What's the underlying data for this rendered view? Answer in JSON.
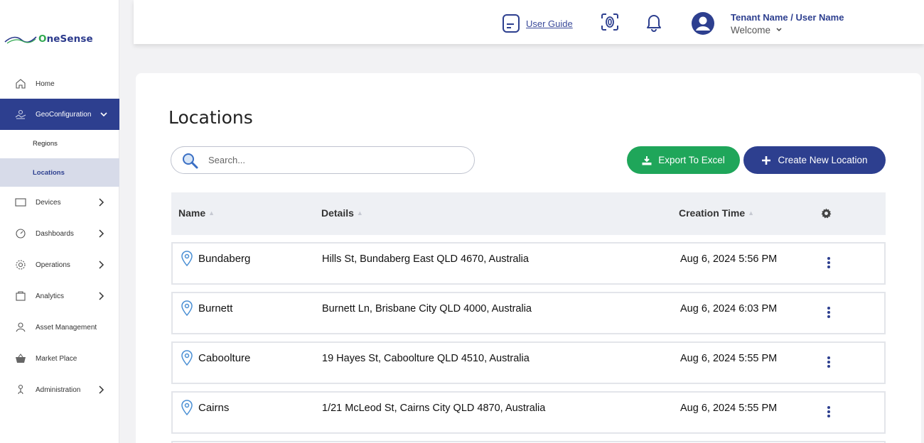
{
  "brand": {
    "logo_text": "neSense",
    "logo_o": "O"
  },
  "sidebar": {
    "items": [
      {
        "label": "Home",
        "icon": "home-icon"
      },
      {
        "label": "GeoConfiguration",
        "icon": "map-icon"
      },
      {
        "label": "Devices",
        "icon": "device-icon"
      },
      {
        "label": "Dashboards",
        "icon": "dashboard-icon"
      },
      {
        "label": "Operations",
        "icon": "gear-icon"
      },
      {
        "label": "Analytics",
        "icon": "analytics-icon"
      },
      {
        "label": "Asset Management",
        "icon": "asset-icon"
      },
      {
        "label": "Market Place",
        "icon": "basket-icon"
      },
      {
        "label": "Administration",
        "icon": "admin-icon"
      }
    ],
    "sub_items": [
      {
        "label": "Regions"
      },
      {
        "label": "Locations"
      }
    ]
  },
  "topbar": {
    "user_guide_label": "User Guide",
    "user_name": "Tenant Name / User Name",
    "welcome": "Welcome"
  },
  "main": {
    "title": "Locations",
    "search_placeholder": "Search...",
    "export_label": "Export To Excel",
    "create_label": "Create New Location",
    "columns": {
      "name": "Name",
      "details": "Details",
      "creation_time": "Creation Time"
    },
    "rows": [
      {
        "name": "Bundaberg",
        "details": "Hills St, Bundaberg East QLD 4670, Australia",
        "time": "Aug 6, 2024 5:56 PM"
      },
      {
        "name": "Burnett",
        "details": "Burnett Ln, Brisbane City QLD 4000, Australia",
        "time": "Aug 6, 2024 6:03 PM"
      },
      {
        "name": "Caboolture",
        "details": "19 Hayes St, Caboolture QLD 4510, Australia",
        "time": "Aug 6, 2024 5:55 PM"
      },
      {
        "name": "Cairns",
        "details": "1/21 McLeod St, Cairns City QLD 4870, Australia",
        "time": "Aug 6, 2024 5:55 PM"
      }
    ]
  },
  "colors": {
    "primary": "#2d3f8f",
    "success": "#1fa65a",
    "sub_selected_bg": "#d7dbe9"
  }
}
